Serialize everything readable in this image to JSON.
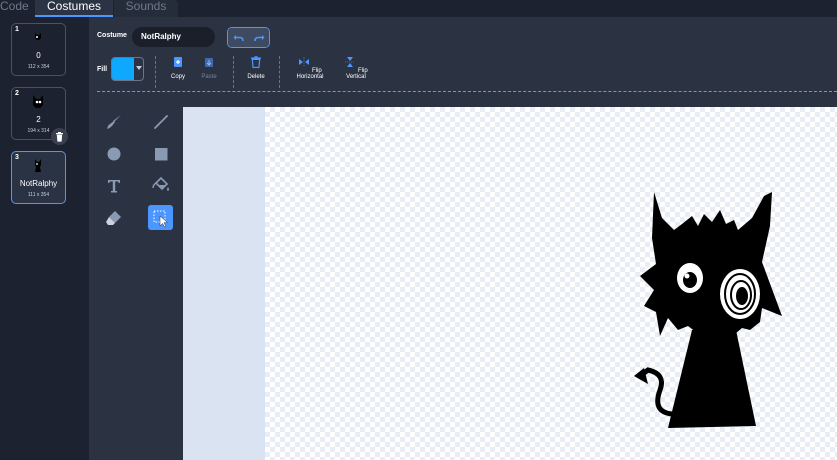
{
  "tabs": [
    {
      "label": "Code"
    },
    {
      "label": "Costumes"
    },
    {
      "label": "Sounds"
    }
  ],
  "costumes": [
    {
      "index": "1",
      "name": "0",
      "size": "112 x 354"
    },
    {
      "index": "2",
      "name": "2",
      "size": "194 x 314"
    },
    {
      "index": "3",
      "name": "NotRalphy",
      "size": "111 x 354"
    }
  ],
  "toolbar": {
    "costume_label": "Costume",
    "costume_name": "NotRalphy",
    "fill_label": "Fill",
    "fill_color": "#0fa8ff",
    "copy_label": "Copy",
    "paste_label": "Paste",
    "delete_label": "Delete",
    "flip_h_label": "Flip Horizontal",
    "flip_v_label": "Flip Vertical"
  },
  "tools": [
    "brush-icon",
    "line-icon",
    "circle-icon",
    "rectangle-icon",
    "text-icon",
    "fill-bucket-icon",
    "eraser-icon",
    "select-icon"
  ],
  "colors": {
    "accent": "#4c97ff",
    "background": "#232a36"
  }
}
